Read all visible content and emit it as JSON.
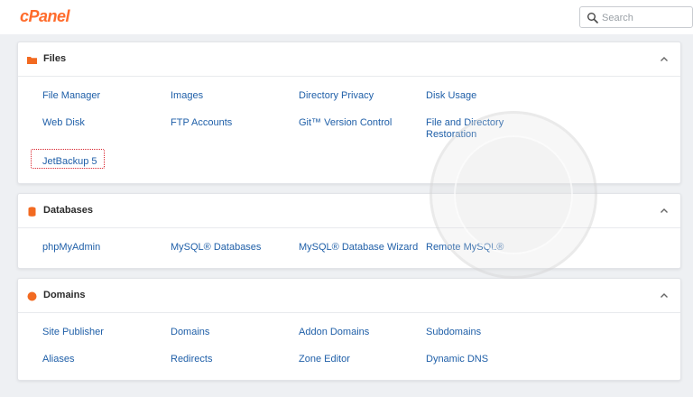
{
  "header": {
    "logo": "cPanel",
    "search_placeholder": "Search"
  },
  "sections": [
    {
      "title": "Files",
      "items": [
        "File Manager",
        "Images",
        "Directory Privacy",
        "Disk Usage",
        "Web Disk",
        "FTP Accounts",
        "Git™ Version Control",
        "File and Directory Restoration",
        "JetBackup 5"
      ]
    },
    {
      "title": "Databases",
      "items": [
        "phpMyAdmin",
        "MySQL® Databases",
        "MySQL® Database Wizard",
        "Remote MySQL®"
      ]
    },
    {
      "title": "Domains",
      "items": [
        "Site Publisher",
        "Domains",
        "Addon Domains",
        "Subdomains",
        "Aliases",
        "Redirects",
        "Zone Editor",
        "Dynamic DNS"
      ]
    }
  ],
  "colors": {
    "brand": "#ff6c2c",
    "link": "#1f5fa8",
    "highlight": "#d9232d"
  }
}
